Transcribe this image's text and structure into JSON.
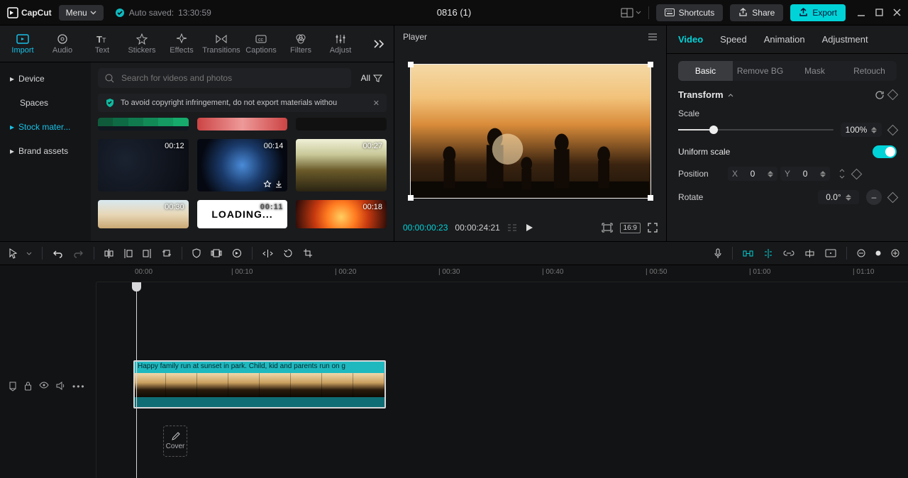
{
  "app": {
    "name": "CapCut",
    "menu_label": "Menu"
  },
  "autosave": {
    "label": "Auto saved:",
    "time": "13:30:59"
  },
  "title": "0816 (1)",
  "top": {
    "shortcuts": "Shortcuts",
    "share": "Share",
    "export": "Export"
  },
  "media_tabs": [
    "Import",
    "Audio",
    "Text",
    "Stickers",
    "Effects",
    "Transitions",
    "Captions",
    "Filters",
    "Adjust"
  ],
  "side_nav": [
    "Device",
    "Spaces",
    "Stock mater...",
    "Brand assets"
  ],
  "search": {
    "placeholder": "Search for videos and photos",
    "all": "All"
  },
  "infobar": "To avoid copyright infringement, do not export materials withou",
  "thumbs": [
    {
      "dur": "00:12"
    },
    {
      "dur": "00:14"
    },
    {
      "dur": "00:27"
    },
    {
      "dur": "00:30"
    },
    {
      "dur": "00:11",
      "loading": "LOADING..."
    },
    {
      "dur": "00:18"
    }
  ],
  "player": {
    "title": "Player",
    "cur": "00:00:00:23",
    "tot": "00:00:24:21",
    "ratio": "16:9"
  },
  "inspector": {
    "tabs": [
      "Video",
      "Speed",
      "Animation",
      "Adjustment"
    ],
    "subtabs": [
      "Basic",
      "Remove BG",
      "Mask",
      "Retouch"
    ],
    "transform": "Transform",
    "scale_label": "Scale",
    "scale_value": "100%",
    "uniform": "Uniform scale",
    "position": "Position",
    "x_label": "X",
    "x_value": "0",
    "y_label": "Y",
    "y_value": "0",
    "rotate": "Rotate",
    "rotate_value": "0.0°"
  },
  "ruler": [
    "00:00",
    "| 00:10",
    "| 00:20",
    "| 00:30",
    "| 00:40",
    "| 00:50",
    "| 01:00",
    "| 01:10"
  ],
  "clip_label": "Happy family run at sunset in park. Child, kid and parents run on g",
  "cover": "Cover"
}
